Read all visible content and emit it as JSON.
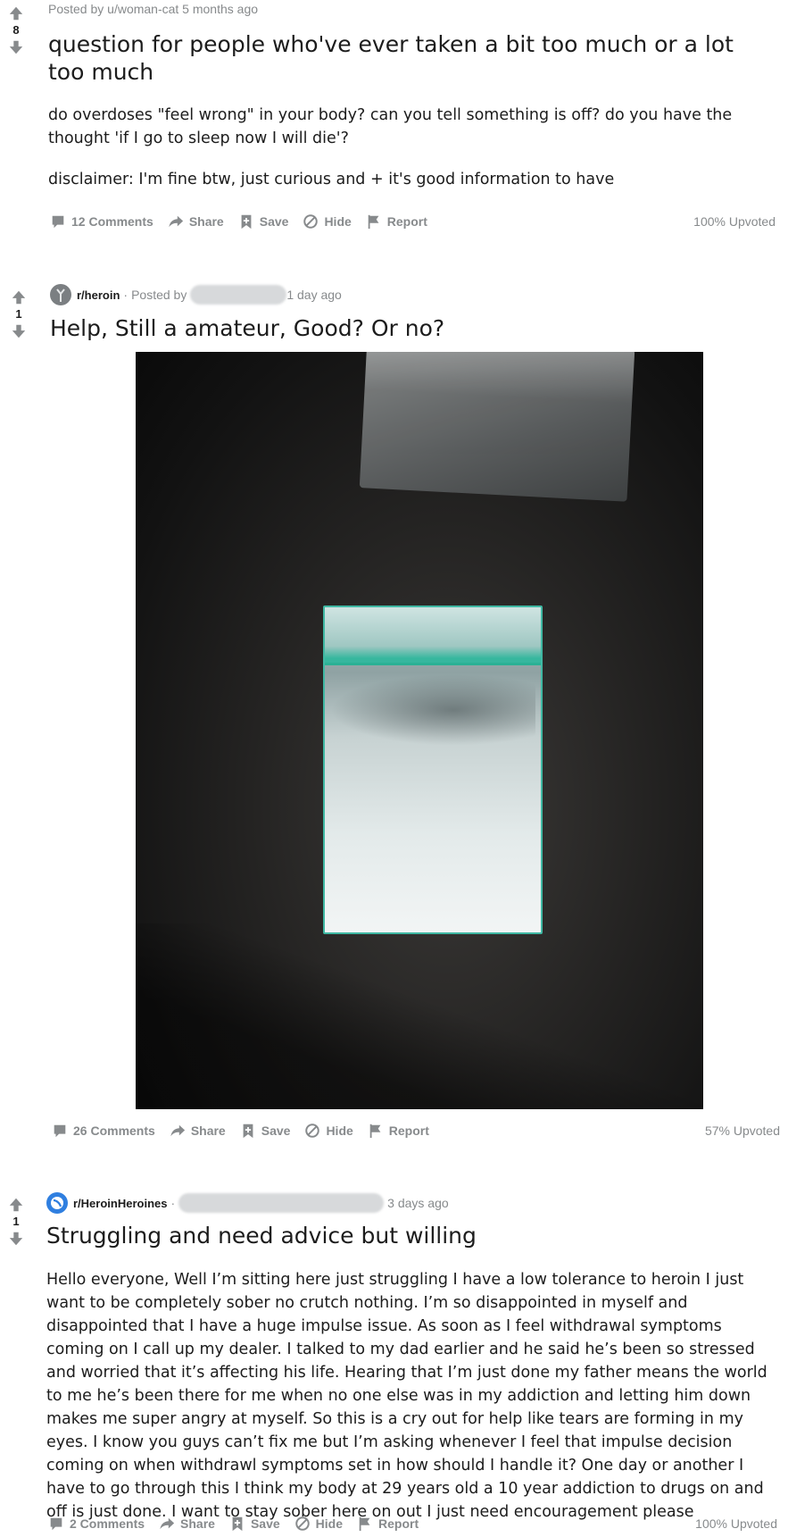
{
  "colors": {
    "icon_gray": "#878a8c",
    "text": "#1c1c1c",
    "meta": "#878a8c",
    "heroin_icon_bg": "#7b7f82",
    "heroines_icon_bg": "#2f7fe0",
    "bag_zip": "#2bb195"
  },
  "posts": [
    {
      "score": "8",
      "posted_by": "Posted by u/woman-cat 5 months ago",
      "title": "question for people who've ever taken a bit too much or a lot too much",
      "body": [
        "do overdoses \"feel wrong\" in your body? can you tell something is off? do you have the thought 'if I go to sleep now I will die'?",
        "disclaimer: I'm fine btw, just curious and + it's good information to have"
      ],
      "actions": {
        "comments": "12 Comments",
        "share": "Share",
        "save": "Save",
        "hide": "Hide",
        "report": "Report"
      },
      "upvoted": "100% Upvoted"
    },
    {
      "score": "1",
      "subreddit": "r/heroin",
      "posted_by_prefix": "Posted by",
      "time": "1 day ago",
      "title": "Help, Still a amateur, Good? Or no?",
      "actions": {
        "comments": "26 Comments",
        "share": "Share",
        "save": "Save",
        "hide": "Hide",
        "report": "Report"
      },
      "upvoted": "57% Upvoted"
    },
    {
      "score": "1",
      "subreddit": "r/HeroinHeroines",
      "time": "3 days ago",
      "title": "Struggling and need advice but willing",
      "body": "Hello everyone, Well I’m sitting here just struggling I have a low tolerance to heroin I just want to be completely sober no crutch nothing. I’m so disappointed in myself and disappointed that I have a huge impulse issue. As soon as I feel withdrawal symptoms coming on I call up my dealer. I talked to my dad earlier and he said he’s been so stressed and worried that it’s affecting his life. Hearing that I’m just done my father means the world to me he’s been there for me when no one else was in my addiction and letting him down makes me super angry at myself. So this is a cry out for help like tears are forming in my eyes. I know you guys can’t fix me but I’m asking whenever I feel that impulse decision coming on when withdrawl symptoms set in how should I handle it? One day or another I have to go through this I think my body at 29 years old a 10 year addiction to drugs on and off is just done. I want to stay sober here on out I just need encouragement please",
      "actions": {
        "comments": "2 Comments",
        "share": "Share",
        "save": "Save",
        "hide": "Hide",
        "report": "Report"
      },
      "upvoted": "100% Upvoted"
    }
  ]
}
